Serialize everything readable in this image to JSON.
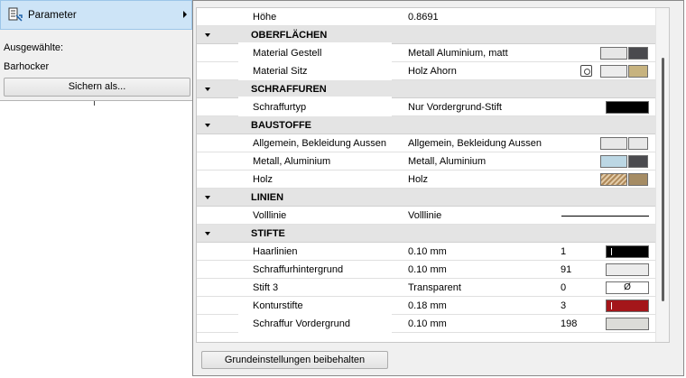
{
  "left_panel": {
    "menu_label": "Parameter",
    "selected_label": "Ausgewählte:",
    "selected_value": "Barhocker",
    "save_as_label": "Sichern als..."
  },
  "dialog": {
    "keep_defaults_label": "Grundeinstellungen beibehalten",
    "rows": [
      {
        "type": "param",
        "name": "Höhe",
        "value": "0.8691"
      },
      {
        "type": "header",
        "title": "OBERFLÄCHEN"
      },
      {
        "type": "param",
        "name": "Material Gestell",
        "value": "Metall Aluminium, matt",
        "highlight": true,
        "swatches": [
          "#e6e6e6",
          "#4a4a4e"
        ]
      },
      {
        "type": "param",
        "name": "Material Sitz",
        "value": "Holz Ahorn",
        "highlight": true,
        "link_icon": "material-link-icon",
        "swatches": [
          "#ececec",
          "#c7b37f"
        ]
      },
      {
        "type": "header",
        "title": "SCHRAFFUREN"
      },
      {
        "type": "param",
        "name": "Schraffurtyp",
        "value": "Nur Vordergrund-Stift",
        "highlight": true,
        "swatch_wide": "#000000"
      },
      {
        "type": "header",
        "title": "BAUSTOFFE"
      },
      {
        "type": "param",
        "name": "Allgemein, Bekleidung Aussen",
        "value": "Allgemein, Bekleidung Aussen",
        "swatches": [
          "#e8e8e8",
          "#e8e8e8"
        ]
      },
      {
        "type": "param",
        "name": "Metall, Aluminium",
        "value": "Metall, Aluminium",
        "swatches": [
          "#bcd7e4",
          "#4a4a4e"
        ]
      },
      {
        "type": "param",
        "name": "Holz",
        "value": "Holz",
        "swatches": [
          "hatch",
          "#a58c64"
        ]
      },
      {
        "type": "header",
        "title": "LINIEN"
      },
      {
        "type": "param",
        "name": "Volllinie",
        "value": "Volllinie",
        "line_sample": true
      },
      {
        "type": "header",
        "title": "STIFTE"
      },
      {
        "type": "param",
        "name": "Haarlinien",
        "value": "0.10 mm",
        "number": "1",
        "pen_color": "#000000",
        "pen_mark": true
      },
      {
        "type": "param",
        "name": "Schraffurhintergrund",
        "value": "0.10 mm",
        "number": "91",
        "pen_color": "#ececec"
      },
      {
        "type": "param",
        "name": "Stift 3",
        "value": "Transparent",
        "number": "0",
        "pen_color": "#ffffff",
        "pen_symbol": "Ø"
      },
      {
        "type": "param",
        "name": "Konturstifte",
        "value": "0.18 mm",
        "number": "3",
        "pen_color": "#a4161a",
        "pen_mark": true
      },
      {
        "type": "param",
        "name": "Schraffur Vordergrund",
        "value": "0.10 mm",
        "number": "198",
        "highlight": true,
        "pen_color": "#dcdcd8"
      }
    ]
  }
}
